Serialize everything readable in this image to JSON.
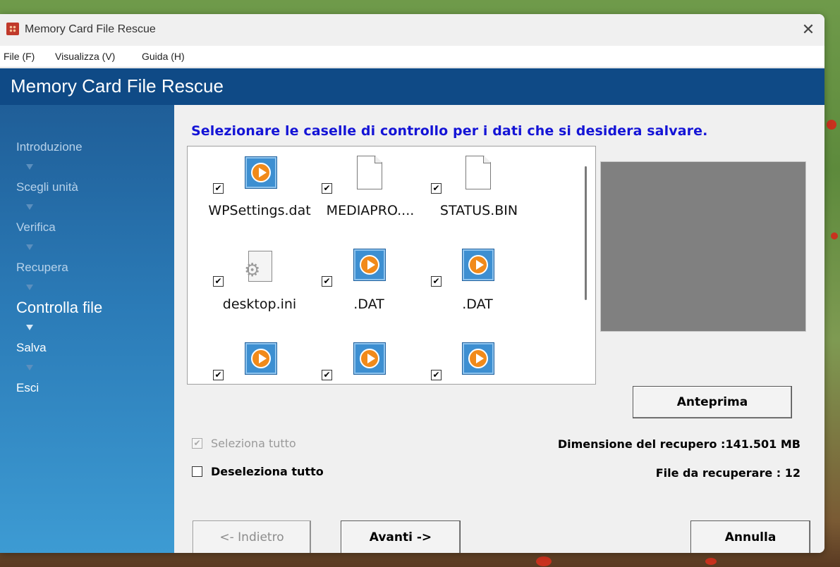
{
  "window": {
    "title": "Memory Card File Rescue",
    "close_symbol": "✕"
  },
  "menu": {
    "items": [
      "File (F)",
      "Visualizza (V)",
      "Guida (H)"
    ]
  },
  "header": {
    "title": "Memory Card File Rescue"
  },
  "sidebar": {
    "steps": [
      {
        "label": "Introduzione",
        "state": "done"
      },
      {
        "label": "Scegli unità",
        "state": "done"
      },
      {
        "label": "Verifica",
        "state": "done"
      },
      {
        "label": "Recupera",
        "state": "done"
      },
      {
        "label": "Controlla file",
        "state": "active"
      },
      {
        "label": "Salva",
        "state": "pending"
      },
      {
        "label": "Esci",
        "state": "pending"
      }
    ]
  },
  "main": {
    "instruction": "Selezionare le caselle di controllo per i dati che si desidera salvare.",
    "files": [
      {
        "name": "WPSettings.dat",
        "icon": "media-file-icon",
        "checked": true
      },
      {
        "name": "MEDIAPRO....",
        "icon": "document-icon",
        "checked": true
      },
      {
        "name": "STATUS.BIN",
        "icon": "document-icon",
        "checked": true
      },
      {
        "name": "desktop.ini",
        "icon": "settings-file-icon",
        "checked": true
      },
      {
        "name": ".DAT",
        "icon": "media-file-icon",
        "checked": true
      },
      {
        "name": ".DAT",
        "icon": "media-file-icon",
        "checked": true
      },
      {
        "name": "",
        "icon": "media-file-icon",
        "checked": true
      },
      {
        "name": "",
        "icon": "media-file-icon",
        "checked": true
      },
      {
        "name": "",
        "icon": "media-file-icon",
        "checked": true
      }
    ],
    "check_mark": "✔",
    "preview_button": "Anteprima",
    "select_all": {
      "label": "Seleziona tutto",
      "checked": true,
      "enabled": false
    },
    "deselect_all": {
      "label": "Deseleziona tutto",
      "checked": false,
      "enabled": true
    },
    "recovery_size": "Dimensione del recupero :141.501 MB",
    "files_to_recover": "File da recuperare : 12"
  },
  "footer": {
    "back_button": "<- Indietro",
    "next_button": "Avanti ->",
    "cancel_button": "Annulla"
  },
  "colors": {
    "header_band": "#0f4a86",
    "instruction_text": "#1414d6",
    "preview_bg": "#808080"
  }
}
